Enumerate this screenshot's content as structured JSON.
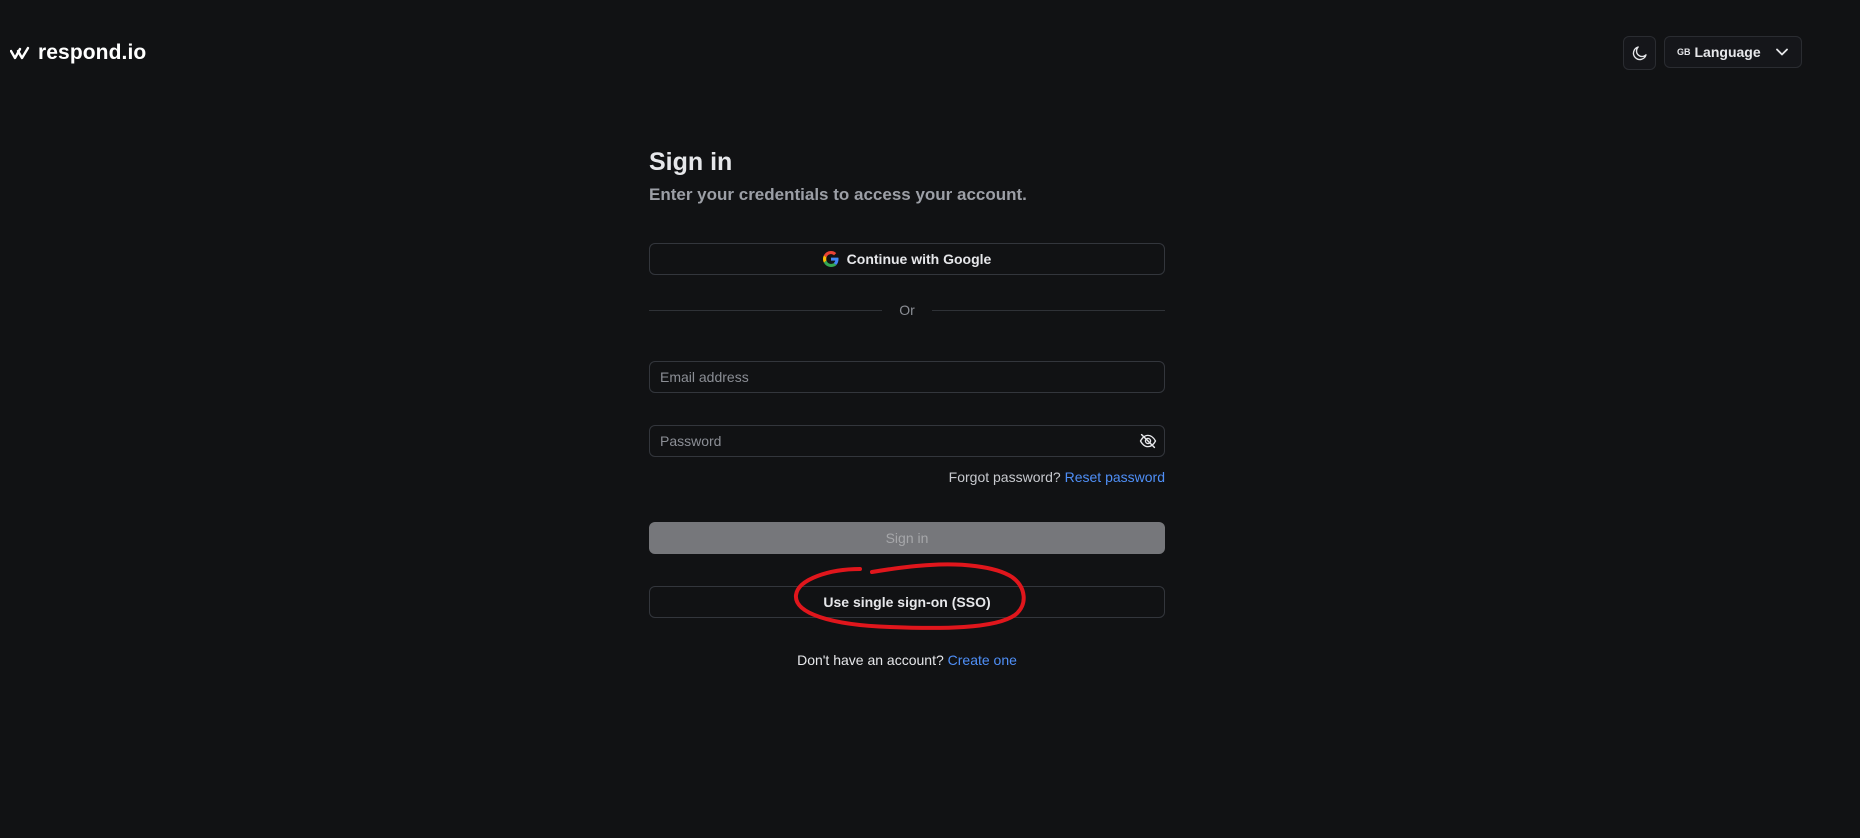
{
  "header": {
    "brand": "respond.io",
    "theme_toggle_icon": "moon-icon",
    "language": {
      "flag_code": "GB",
      "label": "Language",
      "chevron_icon": "chevron-down-icon"
    }
  },
  "form": {
    "title": "Sign in",
    "subtitle": "Enter your credentials to access your account.",
    "google_button_label": "Continue with Google",
    "divider_text": "Or",
    "email_placeholder": "Email address",
    "password_placeholder": "Password",
    "forgot_text": "Forgot password?",
    "reset_link": "Reset password",
    "signin_button_label": "Sign in",
    "sso_button_label": "Use single sign-on (SSO)",
    "no_account_text": "Don't have an account?",
    "create_link": "Create one"
  },
  "colors": {
    "background": "#111214",
    "link": "#4f8ff7",
    "annotation": "#e0161c",
    "disabled_button": "#76777b"
  }
}
